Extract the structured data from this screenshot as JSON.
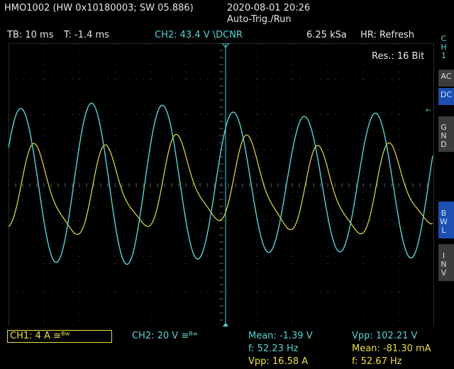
{
  "header": {
    "device": "HMO1002 (HW 0x10180003; SW 05.886)",
    "datetime": "2020-08-01 20:26",
    "trigger_mode": "Auto-Trig./Run"
  },
  "status": {
    "timebase": "TB: 10 ms",
    "trigger_time": "T: -1.4 ms",
    "trigger_info": "CH2: 43.4 V \\DCNR",
    "sample_rate": "6.25 kSa",
    "acq_mode": "HR: Refresh"
  },
  "screen": {
    "resolution": "Res.: 16 Bit"
  },
  "side_menu": {
    "channel": "CH1",
    "buttons": [
      {
        "label": "AC",
        "active": false
      },
      {
        "label": "DC",
        "active": true
      },
      {
        "label": "GND",
        "active": false
      },
      {
        "label": "BWL",
        "active": true
      },
      {
        "label": "INV",
        "active": false
      }
    ]
  },
  "bottom": {
    "ch1_scale": "CH1: 4 A ≅ᴮʷ",
    "ch2_scale": "CH2: 20 V ≅ᴮʷ",
    "ch1_meas": {
      "mean": "Mean: -1.39 V",
      "freq": "f: 52.23 Hz",
      "vpp": "Vpp: 16.58 A"
    },
    "ch2_meas": {
      "vpp": "Vpp: 102.21 V",
      "mean": "Mean: -81.30 mA",
      "freq": "f: 52.67 Hz"
    }
  },
  "colors": {
    "ch1": "#e8e040",
    "ch2": "#58d4d4",
    "grid": "#5a5a5a",
    "active_button": "#1c4fb0"
  }
}
